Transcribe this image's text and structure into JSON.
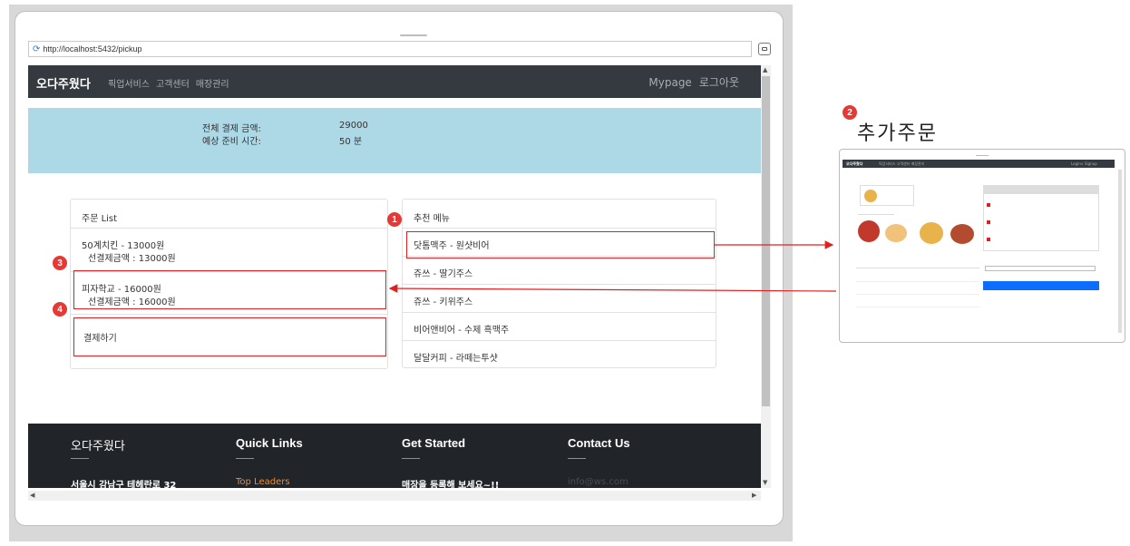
{
  "browser": {
    "url": "http://localhost:5432/pickup"
  },
  "nav": {
    "brand": "오다주웠다",
    "links": [
      "픽업서비스",
      "고객센터",
      "매장관리"
    ],
    "mypage": "Mypage",
    "logout": "로그아웃"
  },
  "summary": {
    "total_label": "전체 결제 금액:",
    "total_value": "29000",
    "time_label": "예상 준비 시간:",
    "time_value": "50 분"
  },
  "order_list": {
    "header": "주문 List",
    "items": [
      {
        "name": "50계치킨  -  13000원",
        "paid": "선결제금액 : 13000원"
      },
      {
        "name": "피자학교  -  16000원",
        "paid": "선결제금액 : 16000원"
      }
    ],
    "pay_button": "결제하기"
  },
  "recommend": {
    "header": "추천 메뉴",
    "items": [
      "닷톰맥주  -  원샷비어",
      "쥬쓰  -  딸기주스",
      "쥬쓰  -  키위주스",
      "비어앤비어  -  수제 흑맥주",
      "달달커피  -  라떼는투샷"
    ]
  },
  "footer": {
    "cols": [
      {
        "title": "오다주웠다",
        "text": "서울시 강남구 테헤란로 32"
      },
      {
        "title": "Quick Links",
        "text": "Top Leaders"
      },
      {
        "title": "Get Started",
        "text": "매장을 등록해 보세요~!!"
      },
      {
        "title": "Contact Us",
        "text": "info@ws.com"
      }
    ]
  },
  "annotations": {
    "badge1": "1",
    "badge2": "2",
    "badge3": "3",
    "badge4": "4",
    "mini_title": "추가주문",
    "mini_brand": "오다주웠다",
    "mini_nav": "픽업서비스  고객센터  매장관리",
    "mini_login": "Login∨  Signup"
  },
  "colors": {
    "annotation_red": "#e02020",
    "nav_dark": "#343a40",
    "hero_blue": "#add8e6",
    "footer_dark": "#212529"
  }
}
